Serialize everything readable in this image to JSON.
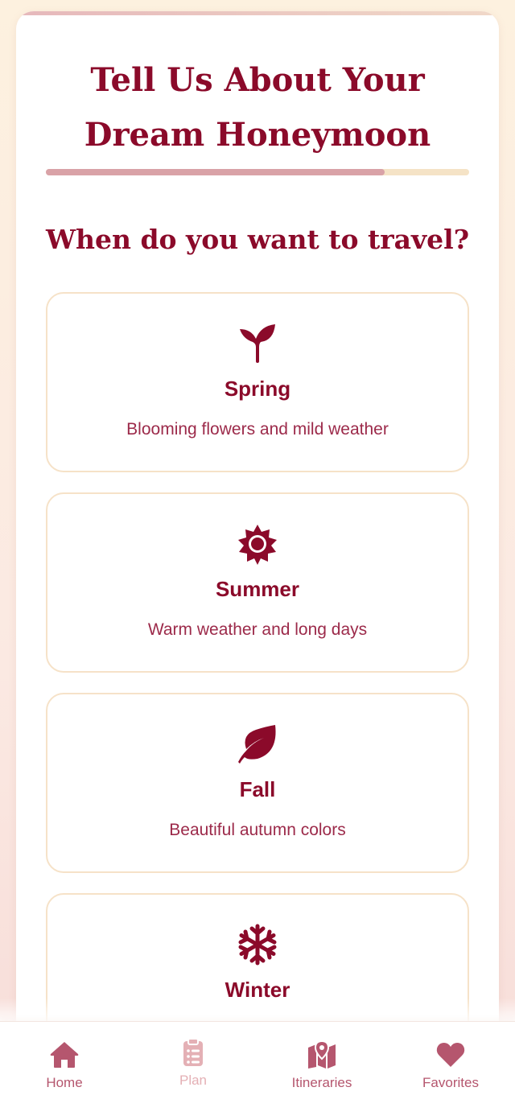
{
  "header": {
    "title": "Tell Us About Your Dream Honeymoon",
    "progress_fraction": 0.8
  },
  "question": "When do you want to travel?",
  "options": [
    {
      "label": "Spring",
      "description": "Blooming flowers and mild weather",
      "icon": "seedling-icon"
    },
    {
      "label": "Summer",
      "description": "Warm weather and long days",
      "icon": "sun-icon"
    },
    {
      "label": "Fall",
      "description": "Beautiful autumn colors",
      "icon": "leaf-icon"
    },
    {
      "label": "Winter",
      "description": "",
      "icon": "snowflake-icon"
    }
  ],
  "nav": [
    {
      "label": "Home",
      "icon": "home-icon"
    },
    {
      "label": "Plan",
      "icon": "clipboard-icon"
    },
    {
      "label": "Itineraries",
      "icon": "map-icon"
    },
    {
      "label": "Favorites",
      "icon": "heart-icon"
    }
  ],
  "colors": {
    "primary": "#8b0a2a",
    "nav_active": "#b5566e",
    "nav_dim": "#e4b0b5",
    "progress_fill": "#d9a2a7",
    "progress_track": "#f5e3c6",
    "option_border": "#f6e2c8"
  }
}
